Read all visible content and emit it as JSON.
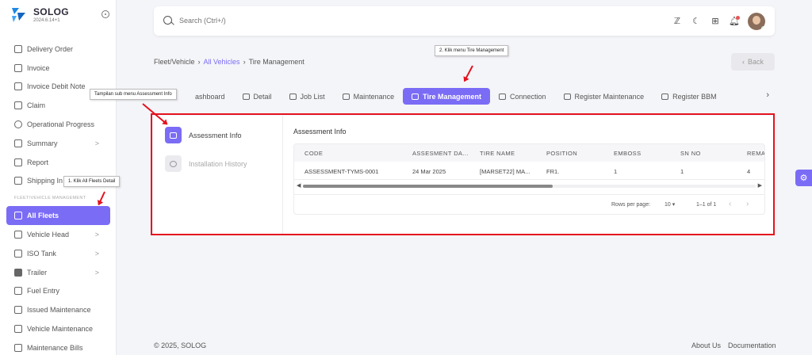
{
  "brand": {
    "name": "SOLOG",
    "version": "2024.6.14+1"
  },
  "sidebar": {
    "items_top": [
      {
        "label": "Delivery Order",
        "icon": "truck-icon"
      },
      {
        "label": "Invoice",
        "icon": "file-icon"
      },
      {
        "label": "Invoice Debit Note",
        "icon": "file-icon"
      },
      {
        "label": "Claim",
        "icon": "file-icon"
      },
      {
        "label": "Operational Progress",
        "icon": "gauge-icon"
      },
      {
        "label": "Summary",
        "icon": "list-icon",
        "chevron": ">"
      },
      {
        "label": "Report",
        "icon": "report-icon"
      },
      {
        "label": "Shipping In",
        "icon": "shipping-icon"
      }
    ],
    "section_label": "FLEET/VEHICLE MANAGEMENT",
    "active_item": "All Fleets",
    "items_bottom": [
      {
        "label": "Vehicle Head",
        "icon": "vehicle-icon",
        "chevron": ">"
      },
      {
        "label": "ISO Tank",
        "icon": "tank-icon",
        "chevron": ">"
      },
      {
        "label": "Trailer",
        "icon": "trailer-icon",
        "chevron": ">"
      },
      {
        "label": "Fuel Entry",
        "icon": "fuel-icon"
      },
      {
        "label": "Issued Maintenance",
        "icon": "file-icon"
      },
      {
        "label": "Vehicle Maintenance",
        "icon": "car-icon"
      },
      {
        "label": "Maintenance Bills",
        "icon": "bill-icon"
      }
    ]
  },
  "topbar": {
    "search_placeholder": "Search (Ctrl+/)"
  },
  "breadcrumb": {
    "root": "Fleet/Vehicle",
    "sep": "›",
    "link": "All Vehicles",
    "current": "Tire Management"
  },
  "back_label": "Back",
  "tabs": [
    {
      "label": "ashboard"
    },
    {
      "label": "Detail"
    },
    {
      "label": "Job List"
    },
    {
      "label": "Maintenance"
    },
    {
      "label": "Tire Management"
    },
    {
      "label": "Connection"
    },
    {
      "label": "Register Maintenance"
    },
    {
      "label": "Register BBM"
    }
  ],
  "sub_menu": [
    {
      "label": "Assessment Info",
      "active": true
    },
    {
      "label": "Installation History",
      "active": false
    }
  ],
  "panel_title": "Assessment Info",
  "table": {
    "columns": [
      "CODE",
      "ASSESMENT DA...",
      "TIRE NAME",
      "POSITION",
      "EMBOSS",
      "SN NO",
      "REMA"
    ],
    "rows": [
      [
        "ASSESSMENT-TYMS-0001",
        "24 Mar 2025",
        "[MARSET22] MA...",
        "FR1.",
        "1",
        "1",
        "4"
      ]
    ]
  },
  "pager": {
    "rows_label": "Rows per page:",
    "rows_value": "10",
    "range": "1–1 of 1"
  },
  "annotations": {
    "step1": "1. Klik All Fleets Detail",
    "step2": "2. Klik menu Tire Management",
    "sub": "Tampilan sub menu Assessment Info",
    "color": "#e4121f"
  },
  "footer": {
    "copyright": "© 2025, SOLOG",
    "about": "About Us",
    "docs": "Documentation"
  },
  "colors": {
    "accent": "#7b6cf6"
  }
}
